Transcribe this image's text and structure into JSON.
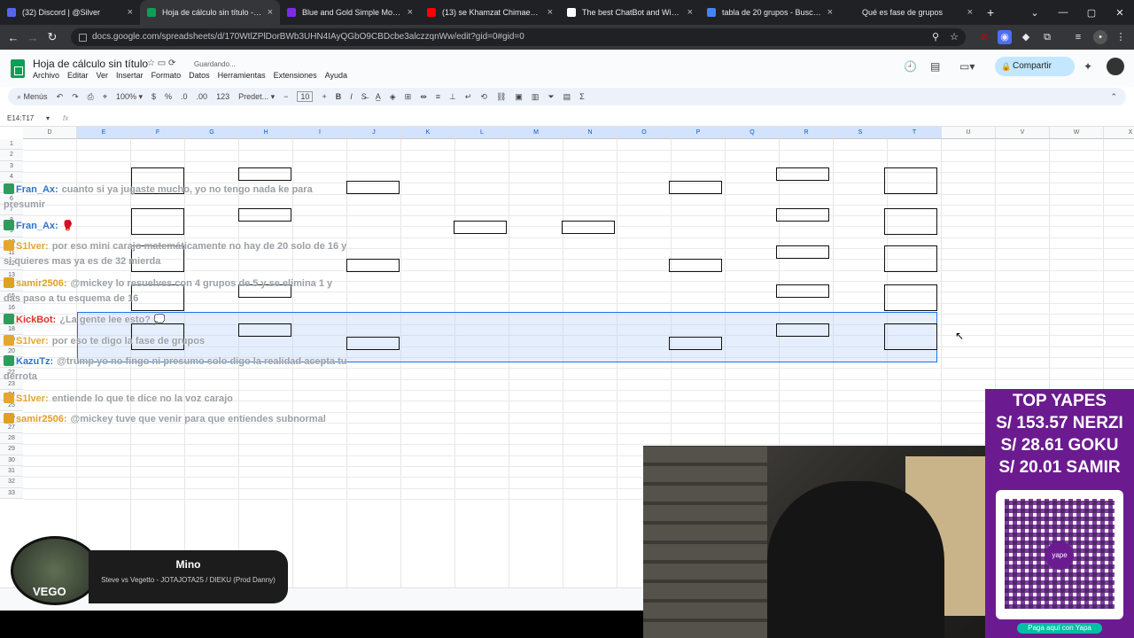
{
  "tabs": [
    {
      "label": "(32) Discord | @Silver",
      "color": "#5865f2"
    },
    {
      "label": "Hoja de cálculo sin título - Hoja",
      "color": "#0f9d58",
      "active": true
    },
    {
      "label": "Blue and Gold Simple Modern",
      "color": "#7d2ae8"
    },
    {
      "label": "(13) se Khamzat Chimaev theme",
      "color": "#ff0000"
    },
    {
      "label": "The best ChatBot and Widgets",
      "color": "#202124"
    },
    {
      "label": "tabla de 20 grupos - Buscar con",
      "color": "#4285f4"
    },
    {
      "label": "Qué es fase de grupos",
      "color": "#202124"
    }
  ],
  "address": {
    "url": "docs.google.com/spreadsheets/d/170WtlZPlDorBWb3UHN4IAyQGbO9CBDcbe3alczzqnWw/edit?gid=0#gid=0"
  },
  "doc": {
    "title": "Hoja de cálculo sin título",
    "status": "Guardando...",
    "menus": [
      "Archivo",
      "Editar",
      "Ver",
      "Insertar",
      "Formato",
      "Datos",
      "Herramientas",
      "Extensiones",
      "Ayuda"
    ],
    "share_label": "Compartir"
  },
  "toolbar": {
    "menus_label": "Menús",
    "zoom": "100%",
    "currency": "$",
    "percent": "%",
    "dec_dec": ".0",
    "dec_inc": ".00",
    "number_fmt": "123",
    "font": "Predet...",
    "font_size": "10",
    "bold": "B",
    "italic": "I"
  },
  "formula": {
    "cell_ref": "E14:T17",
    "fx": "fx"
  },
  "columns": [
    "D",
    "E",
    "F",
    "G",
    "H",
    "I",
    "J",
    "K",
    "L",
    "M",
    "N",
    "O",
    "P",
    "Q",
    "R",
    "S",
    "T",
    "U",
    "V",
    "W",
    "X"
  ],
  "rows": [
    "1",
    "2",
    "3",
    "4",
    "5",
    "6",
    "7",
    "8",
    "9",
    "10",
    "11",
    "12",
    "13",
    "14",
    "15",
    "16",
    "17",
    "18",
    "19",
    "20",
    "21",
    "22",
    "23",
    "24",
    "25",
    "26",
    "27",
    "28",
    "29",
    "30",
    "31",
    "32",
    "33"
  ],
  "chat": [
    {
      "user": "Fran_Ax:",
      "text": "cuanto si ya jugaste mucho, yo no tengo nada ke para presumir",
      "color": "#2f73c9"
    },
    {
      "user": "Fran_Ax:",
      "text": "🥊",
      "color": "#2f73c9"
    },
    {
      "user": "S1lver:",
      "text": "por eso mini carajo matemáticamente no hay de 20 solo de 16 y si quieres mas ya es de 32 mierda",
      "color": "#e7a52e"
    },
    {
      "user": "samir2506:",
      "text": "@mickey lo resuelves con 4 grupos de 5 y se elimina 1 y das paso a tu esquema de 16",
      "color": "#e0a020"
    },
    {
      "user": "KickBot:",
      "text": "¿La gente lee esto? 💭",
      "color": "#1ea34c"
    },
    {
      "user": "S1lver:",
      "text": "por eso te digo la fase de grupos",
      "color": "#e7a52e"
    },
    {
      "user": "KazuTz:",
      "text": "@trump yo no fingo ni presumo solo digo la realidad acepta tu derrota",
      "color": "#2f73c9"
    },
    {
      "user": "S1lver:",
      "text": "entiende lo que te dice no la voz carajo",
      "color": "#e7a52e"
    },
    {
      "user": "samir2506:",
      "text": "@mickey tuve que venir para que entiendes subnormal",
      "color": "#e0a020"
    }
  ],
  "music": {
    "title": "Mino",
    "song": "Steve vs Vegetto - JOTAJOTA25 / DIEKU (Prod Danny)",
    "disc_text": "VEGO"
  },
  "yape": {
    "heading": "TOP YAPES",
    "entries": [
      "S/ 153.57 NERZI",
      "S/ 28.61 GOKU",
      "S/ 20.01 SAMIR"
    ],
    "qr_button": "Paga aquí con Yapa",
    "qr_logo": "yape"
  }
}
